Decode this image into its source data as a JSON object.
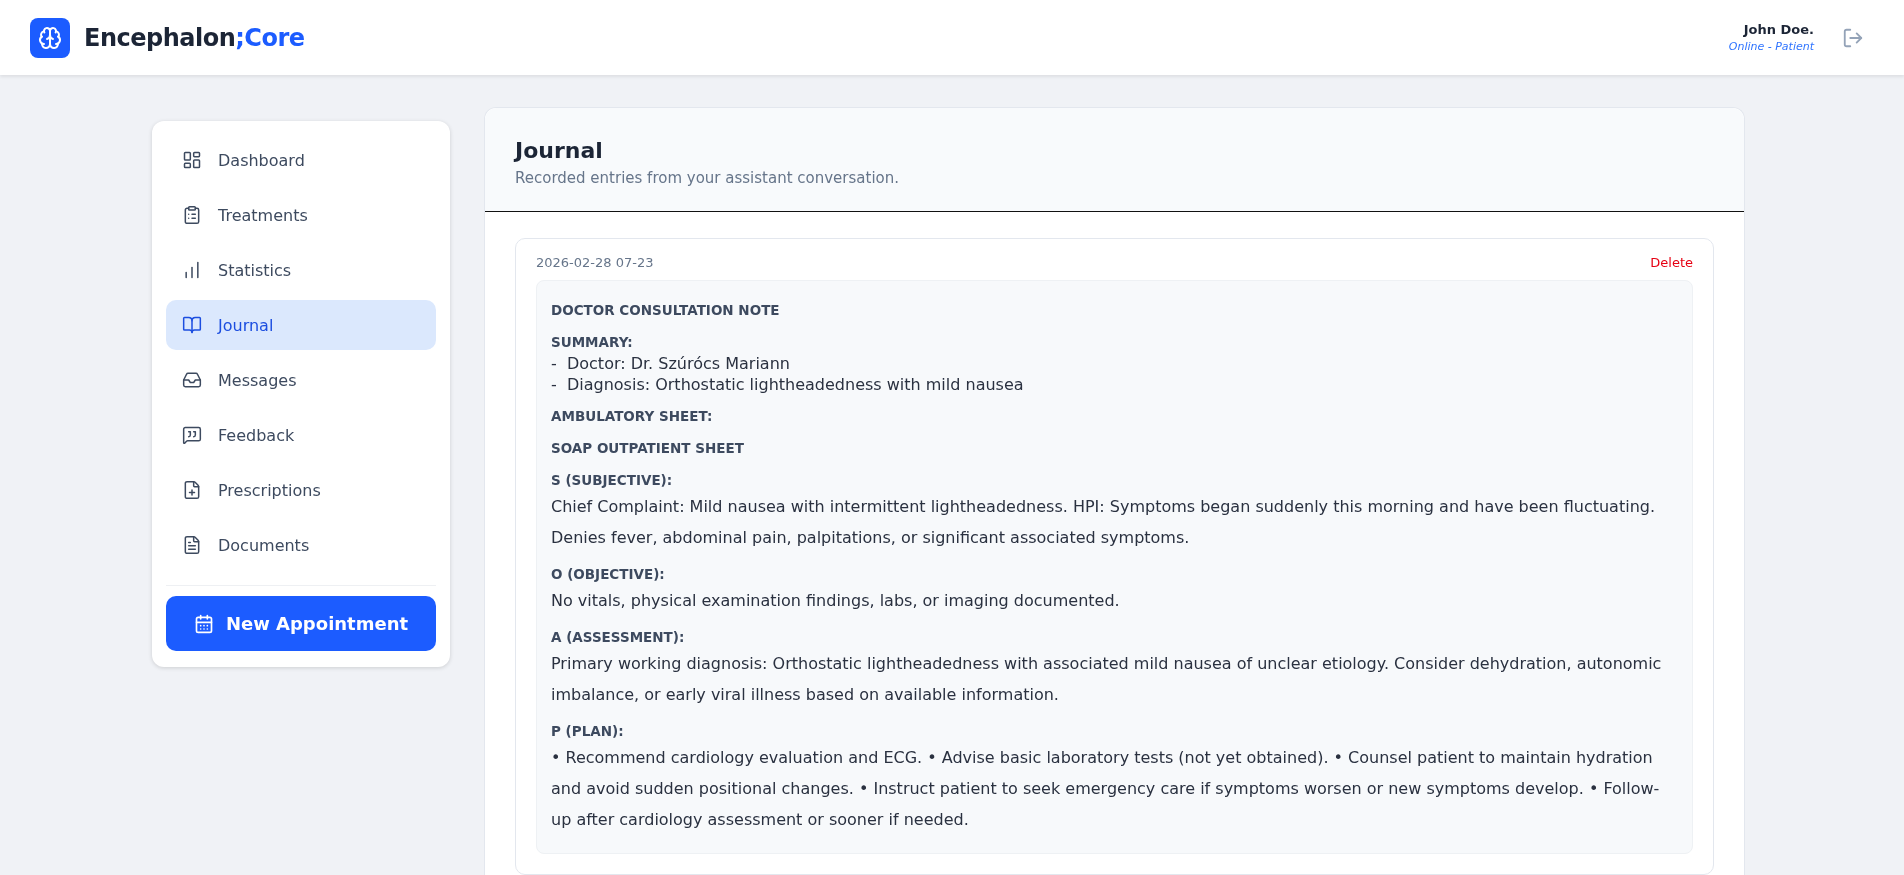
{
  "brand": {
    "name": "Encephalon",
    "suffix": ";Core"
  },
  "user": {
    "name": "John Doe.",
    "status": "Online - Patient"
  },
  "sidebar": {
    "items": [
      {
        "label": "Dashboard",
        "selected": false
      },
      {
        "label": "Treatments",
        "selected": false
      },
      {
        "label": "Statistics",
        "selected": false
      },
      {
        "label": "Journal",
        "selected": true
      },
      {
        "label": "Messages",
        "selected": false
      },
      {
        "label": "Feedback",
        "selected": false
      },
      {
        "label": "Prescriptions",
        "selected": false
      },
      {
        "label": "Documents",
        "selected": false
      }
    ],
    "button": "New Appointment"
  },
  "journal": {
    "title": "Journal",
    "subtitle": "Recorded entries from your assistant conversation.",
    "entries": [
      {
        "date": "2026-02-28 07-23",
        "delete": "Delete",
        "note": [
          {
            "heading": "DOCTOR CONSULTATION NOTE"
          },
          {
            "heading": "SUMMARY:",
            "items": [
              "-  Doctor: Dr. Szúrócs Mariann",
              "-  Diagnosis: Orthostatic lightheadedness with mild nausea"
            ]
          },
          {
            "heading": "AMBULATORY SHEET:"
          },
          {
            "heading": "SOAP OUTPATIENT SHEET"
          },
          {
            "heading": "S (SUBJECTIVE):",
            "text": "Chief Complaint: Mild nausea with intermittent lightheadedness. HPI: Symptoms began suddenly this morning and have been fluctuating. Denies fever, abdominal pain, palpitations, or significant associated symptoms."
          },
          {
            "heading": "O (OBJECTIVE):",
            "text": "No vitals, physical examination findings, labs, or imaging documented."
          },
          {
            "heading": "A (ASSESSMENT):",
            "text": "Primary working diagnosis: Orthostatic lightheadedness with associated mild nausea of unclear etiology. Consider dehydration, autonomic imbalance, or early viral illness based on available information."
          },
          {
            "heading": "P (PLAN):",
            "text": "• Recommend cardiology evaluation and ECG. • Advise basic laboratory tests (not yet obtained). • Counsel patient to maintain hydration and avoid sudden positional changes. • Instruct patient to seek emergency care if symptoms worsen or new symptoms develop. • Follow-up after cardiology assessment or sooner if needed."
          }
        ]
      }
    ]
  }
}
